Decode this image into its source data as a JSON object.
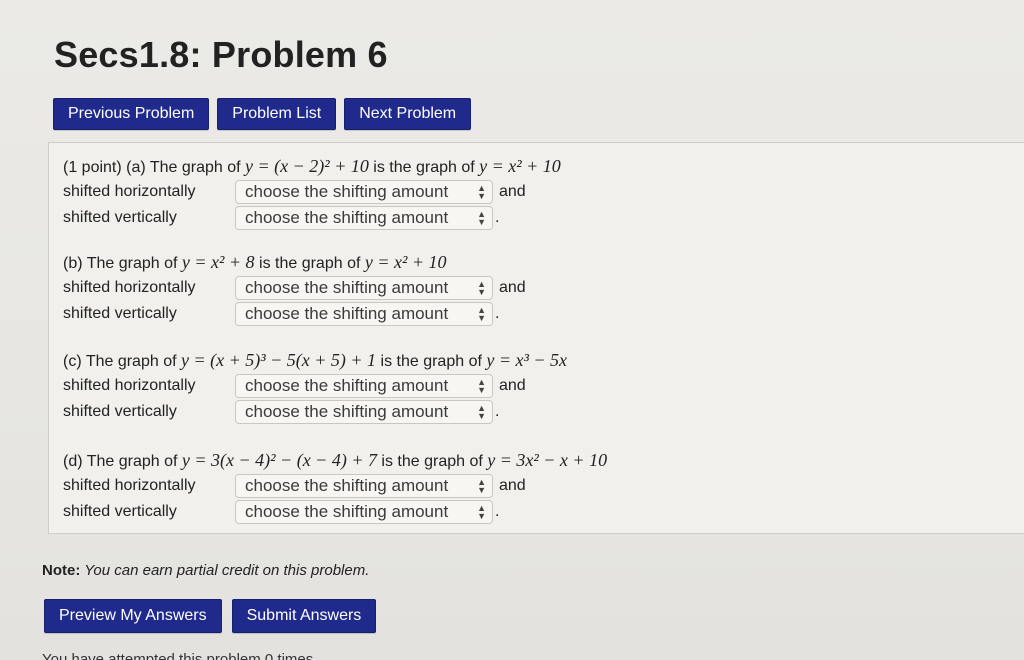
{
  "page": {
    "title": "Secs1.8: Problem 6"
  },
  "nav": {
    "previous": "Previous Problem",
    "list": "Problem List",
    "next": "Next Problem"
  },
  "select_placeholder": "choose the shifting amount",
  "labels": {
    "horizontal": "shifted horizontally",
    "vertical": "shifted vertically",
    "and": "and",
    "period": "."
  },
  "parts": [
    {
      "prefix": "(1 point) (a) The graph of ",
      "eq1": "y = (x − 2)² + 10",
      "middle": " is the graph of ",
      "eq2": "y = x² + 10"
    },
    {
      "prefix": "(b) The graph of ",
      "eq1": "y = x² + 8",
      "middle": " is the graph of ",
      "eq2": "y = x² + 10"
    },
    {
      "prefix": "(c) The graph of ",
      "eq1": "y = (x + 5)³ − 5(x + 5) + 1",
      "middle": " is the graph of ",
      "eq2": "y = x³ − 5x"
    },
    {
      "prefix": "(d) The graph of ",
      "eq1": "y = 3(x − 4)² − (x − 4) + 7",
      "middle": " is the graph of ",
      "eq2": "y = 3x² − x + 10"
    }
  ],
  "note": {
    "bold": "Note:",
    "text": " You can earn partial credit on this problem."
  },
  "actions": {
    "preview": "Preview My Answers",
    "submit": "Submit Answers"
  },
  "footer_cut": "You have attempted this problem 0 times."
}
